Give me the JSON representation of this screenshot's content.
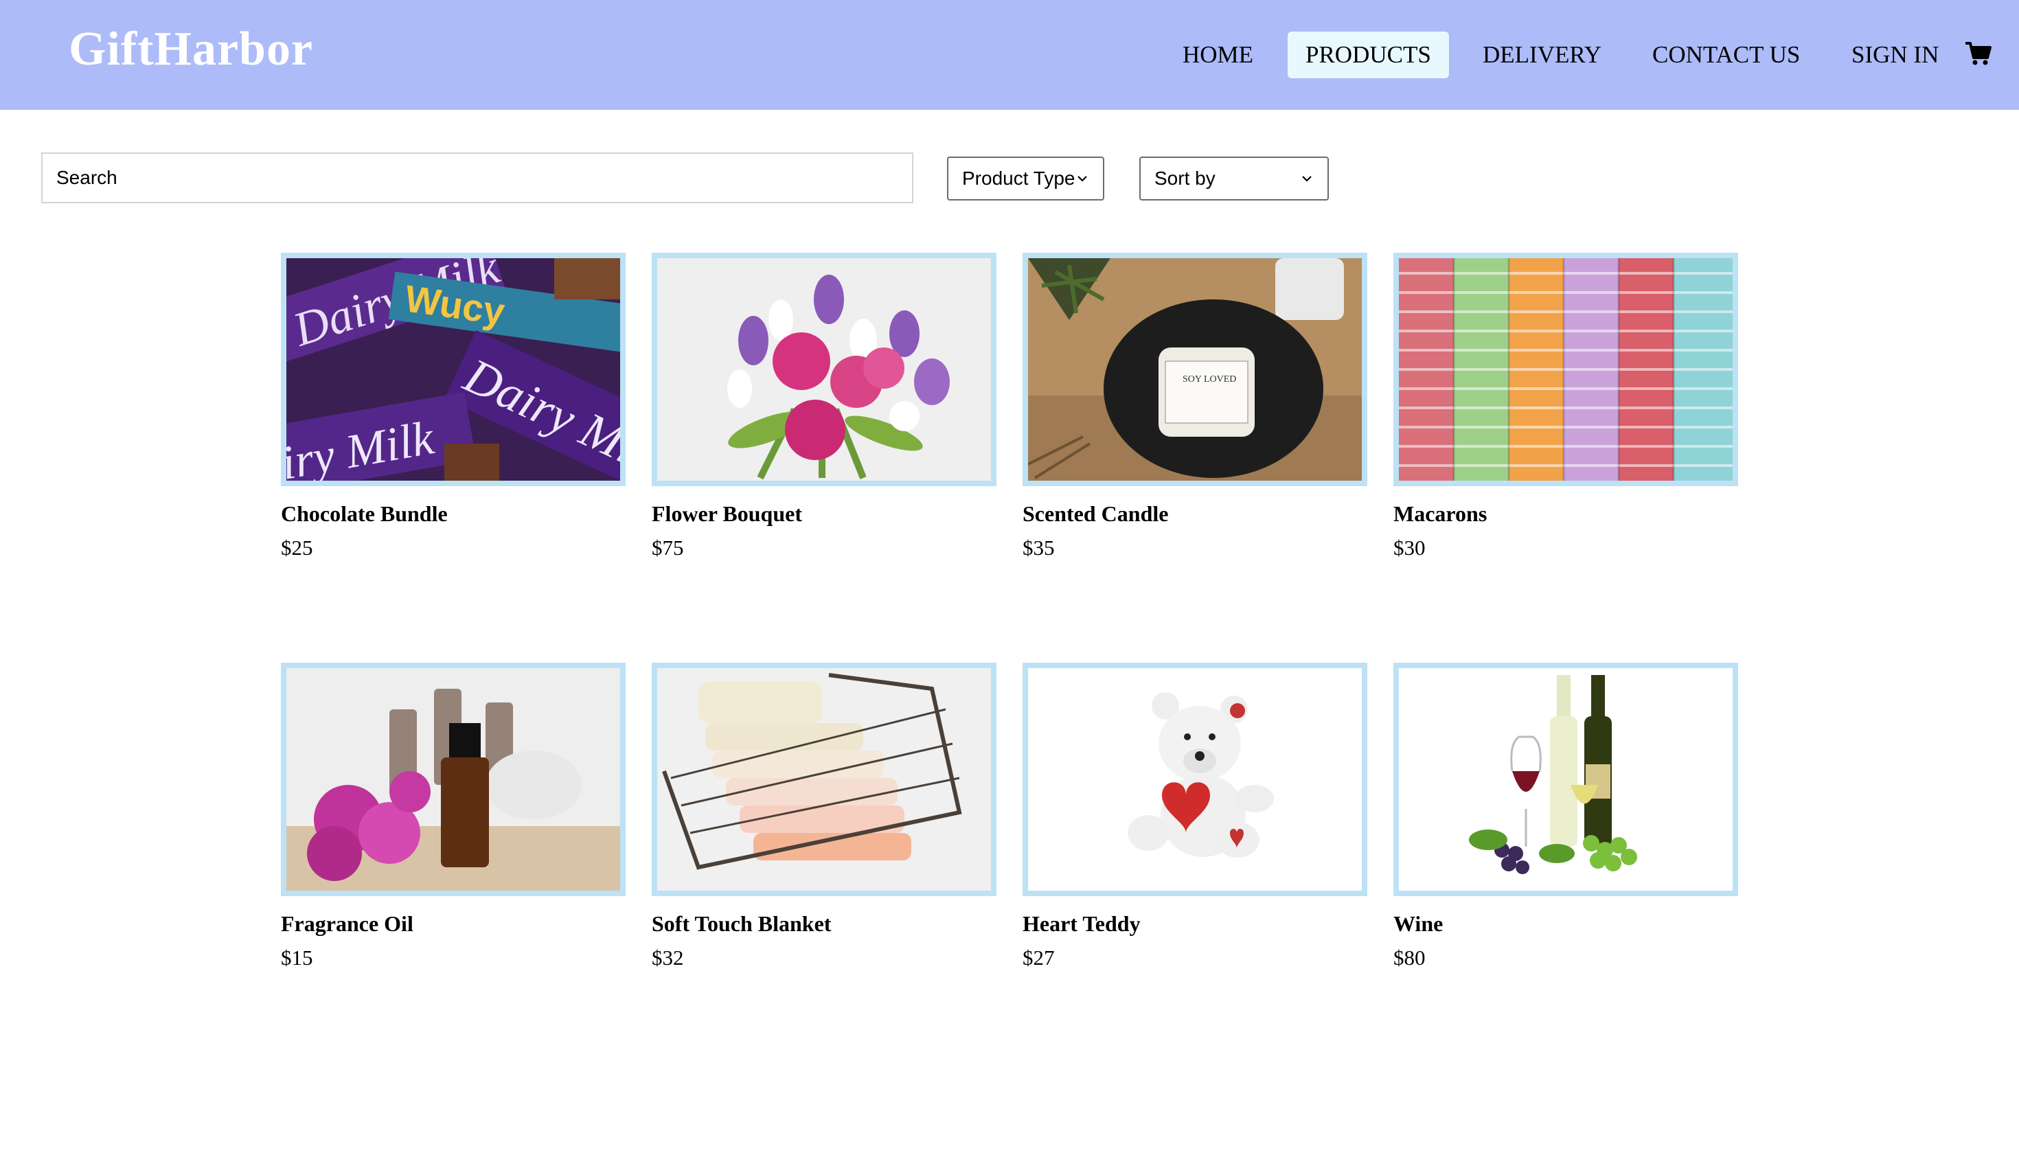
{
  "header": {
    "logo": "GiftHarbor",
    "nav": [
      "HOME",
      "PRODUCTS",
      "DELIVERY",
      "CONTACT US",
      "SIGN IN"
    ],
    "active_nav": "PRODUCTS",
    "cart_icon": "cart-icon",
    "background_color": "#adbbf8",
    "active_color": "#e8f8ff"
  },
  "filters": {
    "search_placeholder": "Search",
    "product_type": "Product Type",
    "sort_by": "Sort by"
  },
  "products": [
    {
      "name": "Chocolate Bundle",
      "price": "$25",
      "image": "chocolate-image"
    },
    {
      "name": "Flower Bouquet",
      "price": "$75",
      "image": "flower-image"
    },
    {
      "name": "Scented Candle",
      "price": "$35",
      "image": "candle-image"
    },
    {
      "name": "Macarons",
      "price": "$30",
      "image": "macarons-image"
    },
    {
      "name": "Fragrance Oil",
      "price": "$15",
      "image": "fragrance-oil-image"
    },
    {
      "name": "Soft Touch Blanket",
      "price": "$32",
      "image": "blanket-image"
    },
    {
      "name": "Heart Teddy",
      "price": "$27",
      "image": "teddy-image"
    },
    {
      "name": "Wine",
      "price": "$80",
      "image": "wine-image"
    }
  ],
  "colors": {
    "card_border": "#bde1f5"
  }
}
